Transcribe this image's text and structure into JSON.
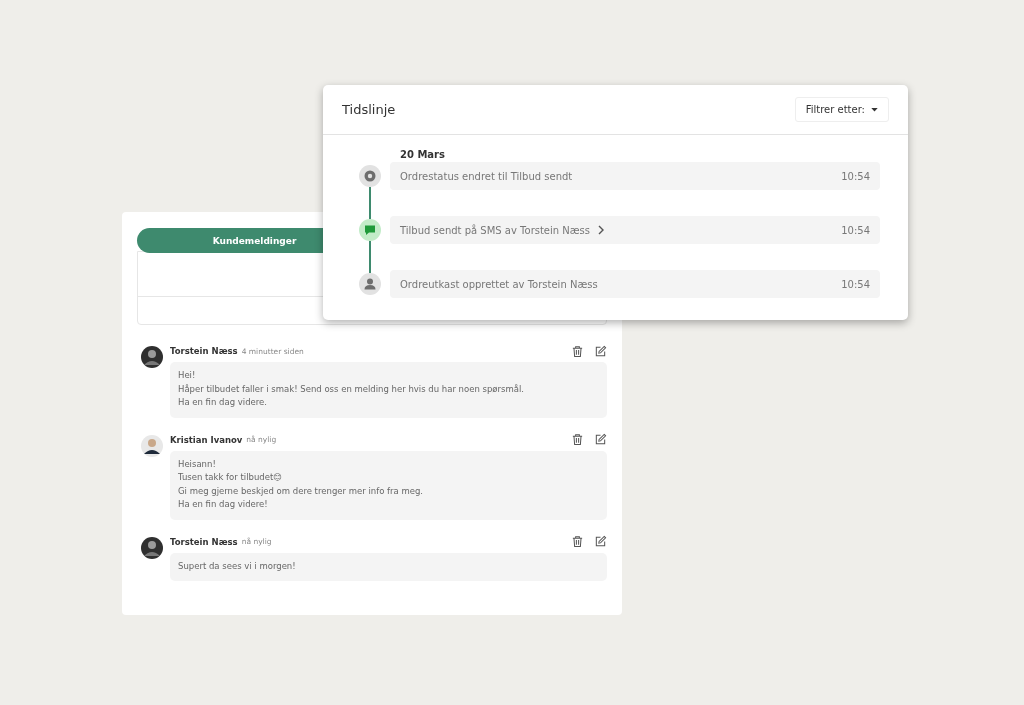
{
  "messages_panel": {
    "tabs": [
      {
        "label": "Kundemeldinger",
        "selected": true
      }
    ],
    "messages": [
      {
        "author": "Torstein Næss",
        "time": "4 minutter siden",
        "kind": "dark",
        "lines": [
          "Hei!",
          "Håper tilbudet faller i smak! Send oss en melding her hvis du har noen spørsmål.",
          "Ha en fin dag videre."
        ]
      },
      {
        "author": "Kristian Ivanov",
        "time": "nå nylig",
        "kind": "light",
        "lines": [
          "Heisann!",
          "Tusen takk for tilbudet😊",
          "Gi meg gjerne beskjed om dere trenger mer info fra meg.",
          "Ha en fin dag videre!"
        ]
      },
      {
        "author": "Torstein Næss",
        "time": "nå nylig",
        "kind": "dark",
        "lines": [
          "Supert da sees vi i morgen!"
        ]
      }
    ]
  },
  "timeline": {
    "title": "Tidslinje",
    "filter": "Filtrer etter:",
    "date": "20 Mars",
    "events": [
      {
        "kind": "status",
        "text": "Ordrestatus endret til Tilbud sendt",
        "time": "10:54",
        "expandable": false
      },
      {
        "kind": "sms",
        "text": "Tilbud sendt på SMS av Torstein Næss",
        "time": "10:54",
        "expandable": true
      },
      {
        "kind": "user",
        "text": "Ordreutkast opprettet av Torstein Næss",
        "time": "10:54",
        "expandable": false
      }
    ]
  }
}
